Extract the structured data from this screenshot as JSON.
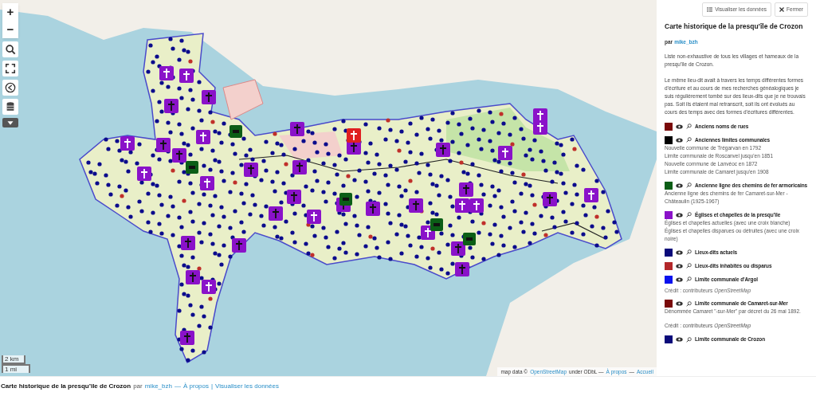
{
  "map": {
    "controls": [
      {
        "kind": "zoom-in",
        "label": "+"
      },
      {
        "kind": "zoom-out",
        "label": "−"
      },
      {
        "kind": "search"
      },
      {
        "kind": "fullscreen"
      },
      {
        "kind": "share"
      },
      {
        "kind": "layers"
      },
      {
        "kind": "more"
      }
    ],
    "scale": [
      "2 km",
      "1 mi"
    ],
    "attribution": {
      "prefix": "map data ©",
      "source": "OpenStreetMap",
      "license": "under ODbL —",
      "links": [
        "À propos",
        "Accueil"
      ],
      "separator": "—"
    }
  },
  "panel": {
    "buttons": [
      {
        "kind": "data",
        "label": "Visualiser les données"
      },
      {
        "kind": "close",
        "label": "Fermer"
      }
    ],
    "title": "Carte historique de la presqu’île de Crozon",
    "author_prefix": "par",
    "author": "mike_bzh",
    "description": [
      "Liste non-exhaustive de tous les villages et hameaux de la presqu’île de Crozon.",
      "Le même lieu-dit avait à travers les temps différentes formes d’écriture et au cours de mes recherches généalogiques je suis régulièrement tombé sur des lieux-dits que je ne trouvais pas. Soit ils étaient mal retranscrit, soit ils ont évolués au cours des temps avec des formes d’écritures différentes."
    ],
    "layers": [
      {
        "name": "Anciens noms de rues",
        "color": "#7a0a0a"
      },
      {
        "name": "Anciennes limites communales",
        "color": "#000000",
        "lines": [
          "Nouvelle commune de Trégarvan en 1792",
          "Limite communale de Roscanvel jusqu'en 1851",
          "Nouvelle commune de Lanvéoc en 1872",
          "Limite communale de Camaret jusqu'en 1908"
        ]
      },
      {
        "name": "Ancienne ligne des chemins de fer armoricains",
        "color": "#0b5e16",
        "lines": [
          "Ancienne ligne des chemins de fer Camaret-sur-Mer - Châteaulin (1925-1967)"
        ]
      },
      {
        "name": "Églises et chapelles de la presqu’île",
        "color": "#8a12c9",
        "lines": [
          "Églises et chapelles actuelles (avec une croix blanche)",
          "Églises et chapelles disparues ou détruites (avec une croix noire)"
        ]
      },
      {
        "name": "Lieux-dits actuels",
        "color": "#0a0a7a"
      },
      {
        "name": "Lieux-dits inhabités ou disparus",
        "color": "#b3282a"
      },
      {
        "name": "Limite communale d'Argol",
        "color": "#0a12ee",
        "note": "Crédit : contributeurs *OpenStreetMap*"
      },
      {
        "name": "Limite communale de Camaret-sur-Mer",
        "color": "#7a0a0a",
        "paragraphs": [
          "Dénommée Camaret \"-sur-Mer\" par décret du 26 mai 1892.",
          "Crédit : contributeurs *OpenStreetMap*"
        ]
      },
      {
        "name": "Limite communale de Crozon",
        "color": "#0a0a7a"
      }
    ]
  },
  "footer": {
    "title": "Carte historique de la presqu’île de Crozon",
    "author_prefix": "par",
    "author": "mike_bzh",
    "links": [
      {
        "sep": "—",
        "label": "À propos"
      },
      {
        "sep": "|",
        "label": "Visualiser les données"
      }
    ]
  }
}
